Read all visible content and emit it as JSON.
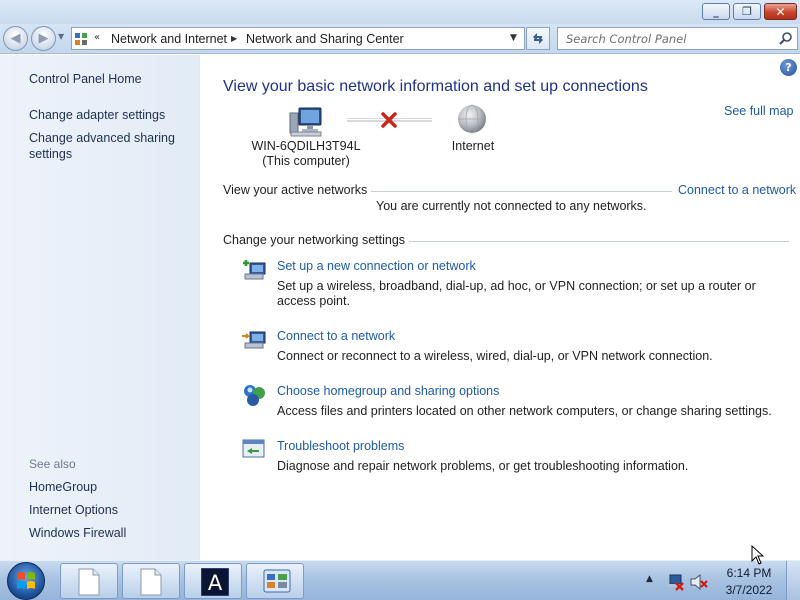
{
  "window": {
    "minimize_glyph": "_",
    "maximize_glyph": "❐",
    "close_glyph": "✕"
  },
  "nav": {
    "back_glyph": "◀",
    "forward_glyph": "▶",
    "recent_glyph": "▼",
    "breadcrumb_overflow": "«",
    "breadcrumb": [
      "Network and Internet",
      "Network and Sharing Center"
    ],
    "breadcrumb_separator": "▶",
    "dropdown_glyph": "▼",
    "search_placeholder": "Search Control Panel"
  },
  "sidebar": {
    "links": [
      {
        "label": "Control Panel Home"
      },
      {
        "label": "Change adapter settings"
      },
      {
        "label": "Change advanced sharing settings"
      }
    ],
    "see_also_label": "See also",
    "see_also": [
      {
        "label": "HomeGroup"
      },
      {
        "label": "Internet Options"
      },
      {
        "label": "Windows Firewall"
      }
    ]
  },
  "main": {
    "help_glyph": "?",
    "title": "View your basic network information and set up connections",
    "see_full_map": "See full map",
    "network_map": {
      "computer_name": "WIN-6QDILH3T94L",
      "computer_sub": "(This computer)",
      "internet_label": "Internet",
      "connection_status": "disconnected"
    },
    "active_networks_label": "View your active networks",
    "connect_link": "Connect to a network",
    "not_connected_message": "You are currently not connected to any networks.",
    "change_settings_label": "Change your networking settings",
    "tasks": [
      {
        "link": "Set up a new connection or network",
        "description": "Set up a wireless, broadband, dial-up, ad hoc, or VPN connection; or set up a router or access point."
      },
      {
        "link": "Connect to a network",
        "description": "Connect or reconnect to a wireless, wired, dial-up, or VPN network connection."
      },
      {
        "link": "Choose homegroup and sharing options",
        "description": "Access files and printers located on other network computers, or change sharing settings."
      },
      {
        "link": "Troubleshoot problems",
        "description": "Diagnose and repair network problems, or get troubleshooting information."
      }
    ]
  },
  "taskbar": {
    "app_a_letter": "A",
    "tray_arrow": "▲",
    "clock_time": "6:14 PM",
    "clock_date": "3/7/2022"
  },
  "colors": {
    "link": "#1e5aa8",
    "title": "#1e3287",
    "sidebar_bg": "#e8eff8",
    "taskbar": "#a9c3e2"
  }
}
